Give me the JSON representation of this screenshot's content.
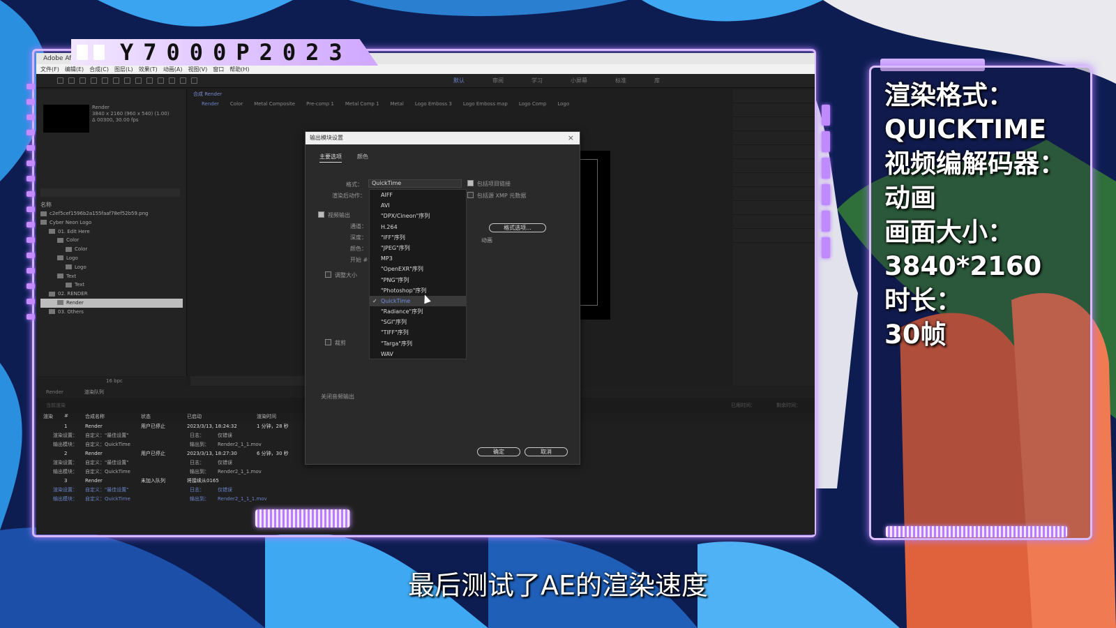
{
  "brand": {
    "title": "Y7000P2023"
  },
  "ae": {
    "window_title": "Adobe Afte",
    "menu": [
      "文件(F)",
      "编辑(E)",
      "合成(C)",
      "图层(L)",
      "效果(T)",
      "动画(A)",
      "视图(V)",
      "窗口",
      "帮助(H)"
    ],
    "workspaces": [
      "默认",
      "审阅",
      "学习",
      "小屏幕",
      "标准",
      "库"
    ],
    "project": {
      "comp_name": "Render",
      "comp_info_1": "3840 x 2160 (960 x 540) (1.00)",
      "comp_info_2": "Δ 00300, 30.00 fps",
      "col_name": "名称",
      "tree": [
        {
          "label": "c2ef5cef1596b2a155faaf78ef52b59.png",
          "indent": 0
        },
        {
          "label": "Cyber Neon Logo",
          "indent": 0
        },
        {
          "label": "01. Edit Here",
          "indent": 1
        },
        {
          "label": "Color",
          "indent": 2
        },
        {
          "label": "Color",
          "indent": 3
        },
        {
          "label": "Logo",
          "indent": 2
        },
        {
          "label": "Logo",
          "indent": 3
        },
        {
          "label": "Text",
          "indent": 2
        },
        {
          "label": "Text",
          "indent": 3
        },
        {
          "label": "02. RENDER",
          "indent": 1
        },
        {
          "label": "Render",
          "indent": 2,
          "selected": true
        },
        {
          "label": "03. Others",
          "indent": 1
        }
      ],
      "footer": "16 bpc"
    },
    "comp": {
      "tab": "合成 Render",
      "crumbs": [
        "Render",
        "Color",
        "Metal Composite",
        "Pre-comp 1",
        "Metal Comp 1",
        "Metal",
        "Logo Emboss 3",
        "Logo Emboss map",
        "Logo Comp",
        "Logo"
      ]
    },
    "render_queue": {
      "tabs": [
        "Render",
        "渲染队列"
      ],
      "current_render": "当前渲染",
      "elapsed": "已用时间：",
      "remaining": "剩余时间：",
      "headers": [
        "渲染",
        "#",
        "合成名称",
        "状态",
        "已启动",
        "渲染时间"
      ],
      "items": [
        {
          "num": "1",
          "name": "Render",
          "status": "用户已停止",
          "started": "2023/3/13, 18:24:32",
          "time": "1 分钟，28 秒",
          "settings": "自定义：\"最佳设置\"",
          "module": "自定义：QuickTime",
          "log": "仅错误",
          "output": "Render2_1_1.mov"
        },
        {
          "num": "2",
          "name": "Render",
          "status": "用户已停止",
          "started": "2023/3/13, 18:27:30",
          "time": "6 分钟，30 秒",
          "settings": "自定义：\"最佳设置\"",
          "module": "自定义：QuickTime",
          "log": "仅错误",
          "output": "Render2_1_1.mov"
        },
        {
          "num": "3",
          "name": "Render",
          "status": "未加入队列",
          "started": "将接续从0165",
          "time": "",
          "settings": "自定义：\"最佳设置\"",
          "module": "自定义：QuickTime",
          "log": "仅错误",
          "output": "Render2_1_1_1.mov"
        }
      ],
      "labels": {
        "render_settings": "渲染设置：",
        "output_module": "输出模块：",
        "log": "日志：",
        "output_to": "输出到："
      }
    }
  },
  "dialog": {
    "title": "输出模块设置",
    "tabs": [
      "主要选项",
      "颜色"
    ],
    "format_label": "格式：",
    "format_value": "QuickTime",
    "post_render_label": "渲染后动作：",
    "include_project_link": "包括项目链接",
    "include_xmp": "包括源 XMP 元数据",
    "video_output": "视频输出",
    "channels": "通道：",
    "depth": "深度：",
    "color": "颜色：",
    "start": "开始 #：",
    "resize": "调整大小",
    "crop": "裁剪",
    "format_options_btn": "格式选项...",
    "codec_text": "动画",
    "audio_off": "关闭音频输出",
    "ok": "确定",
    "cancel": "取消"
  },
  "dropdown": {
    "items": [
      "AIFF",
      "AVI",
      "\"DPX/Cineon\"序列",
      "H.264",
      "\"IFF\"序列",
      "\"JPEG\"序列",
      "MP3",
      "\"OpenEXR\"序列",
      "\"PNG\"序列",
      "\"Photoshop\"序列",
      "QuickTime",
      "\"Radiance\"序列",
      "\"SGI\"序列",
      "\"TIFF\"序列",
      "\"Targa\"序列",
      "WAV"
    ],
    "selected": "QuickTime"
  },
  "info": {
    "lines": [
      "渲染格式：",
      "QUICKTIME",
      "视频编解码器：",
      "动画",
      "画面大小：",
      "3840*2160",
      "时长：",
      "30帧"
    ]
  },
  "subtitle": "最后测试了AE的渲染速度"
}
